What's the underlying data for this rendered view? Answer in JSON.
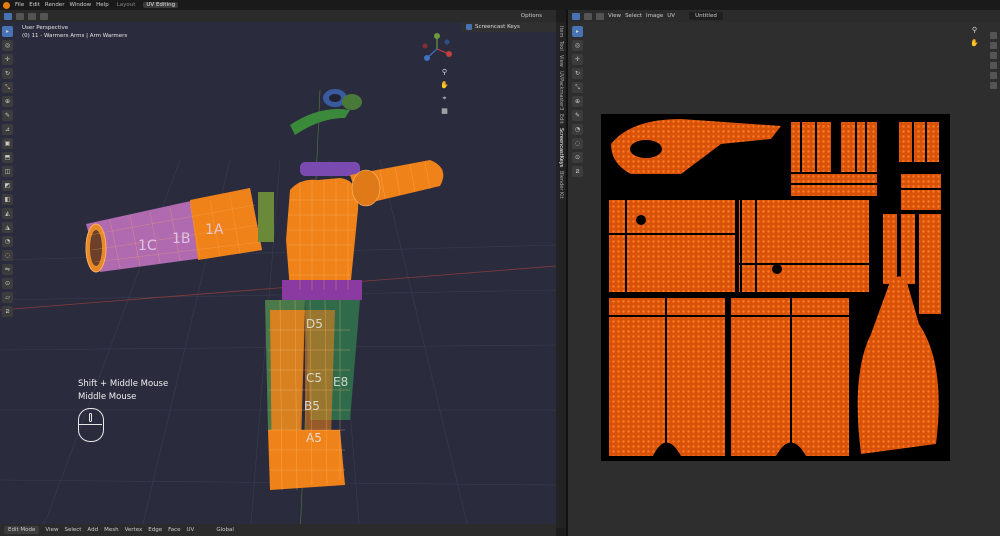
{
  "app": {
    "menus": [
      "File",
      "Edit",
      "Render",
      "Window",
      "Help"
    ],
    "tabs": [
      {
        "label": "Layout",
        "active": false
      },
      {
        "label": "UV Editing",
        "active": true
      }
    ]
  },
  "viewport": {
    "options_label": "Options",
    "info_line1": "User Perspective",
    "info_line2": "(0) 11 - Warmers Arms | Arm Warmers",
    "screencast_label": "Screencast Keys",
    "sidetabs": [
      "Item",
      "Tool",
      "View",
      "UVPackmaster3",
      "Edit",
      "ScreencastKeys",
      "Blender Kit"
    ],
    "active_sidetab": "ScreencastKeys",
    "key_line1": "Shift + Middle Mouse",
    "key_line2": "Middle Mouse",
    "bottom": {
      "mode": "Edit Mode",
      "menus": [
        "View",
        "Select",
        "Add",
        "Mesh",
        "Vertex",
        "Edge",
        "Face",
        "UV"
      ],
      "orientation": "Global"
    },
    "arm_labels": [
      "1C",
      "1B",
      "1A"
    ],
    "leg_labels": [
      "D5",
      "C5",
      "B5",
      "A5",
      "E8"
    ],
    "colors": {
      "viewport_bg": "#2a2b3d",
      "mesh": "#f0821a",
      "wire": "#ffb05a",
      "accent": "#4772b3"
    }
  },
  "uv_editor": {
    "menus": [
      "View",
      "Select",
      "Image",
      "UV"
    ],
    "image_name": "Untitled",
    "colors": {
      "canvas": "#000000",
      "uv_fill": "#d8520a",
      "uv_vertex": "#ff6a10"
    }
  },
  "icons": {
    "toolbar": [
      "select-icon",
      "cursor-icon",
      "move-icon",
      "rotate-icon",
      "scale-icon",
      "transform-icon",
      "annotate-icon",
      "measure-icon",
      "add-cube-icon",
      "extrude-icon",
      "inset-icon",
      "bevel-icon",
      "loop-cut-icon",
      "knife-icon",
      "poly-build-icon",
      "spin-icon",
      "smooth-icon",
      "edge-slide-icon",
      "shrink-icon",
      "shear-icon",
      "rip-icon"
    ],
    "nav": [
      "zoom-icon",
      "pan-icon",
      "camera-icon",
      "grid-icon"
    ]
  }
}
